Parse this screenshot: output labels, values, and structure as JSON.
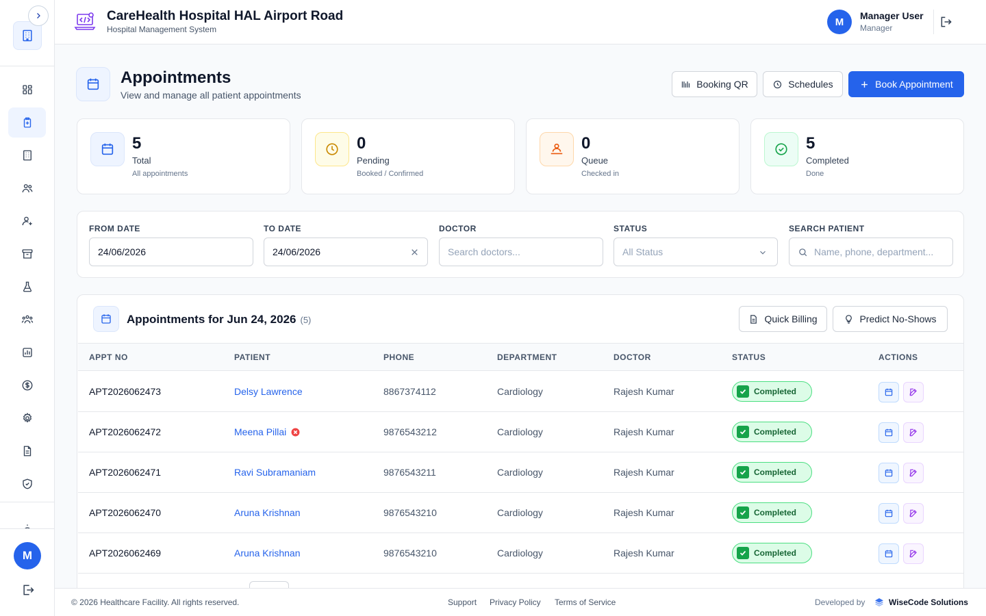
{
  "header": {
    "title": "CareHealth Hospital HAL Airport Road",
    "subtitle": "Hospital Management System",
    "user_initial": "M",
    "user_name": "Manager User",
    "user_role": "Manager"
  },
  "sidebar": {
    "user_initial": "M",
    "items": [
      {
        "icon": "dashboard-icon"
      },
      {
        "icon": "clipboard-icon",
        "active": true
      },
      {
        "icon": "building-icon"
      },
      {
        "icon": "users-icon"
      },
      {
        "icon": "user-plus-icon"
      },
      {
        "icon": "archive-icon"
      },
      {
        "icon": "flask-icon"
      },
      {
        "icon": "team-icon"
      },
      {
        "icon": "bar-chart-icon"
      },
      {
        "icon": "dollar-icon"
      },
      {
        "icon": "gear-icon"
      },
      {
        "icon": "document-icon"
      },
      {
        "icon": "shield-icon"
      }
    ]
  },
  "page": {
    "title": "Appointments",
    "subtitle": "View and manage all patient appointments",
    "buttons": {
      "booking_qr": "Booking QR",
      "schedules": "Schedules",
      "book": "Book Appointment"
    }
  },
  "stats": [
    {
      "value": "5",
      "label": "Total",
      "desc": "All appointments",
      "color": "#2563eb"
    },
    {
      "value": "0",
      "label": "Pending",
      "desc": "Booked / Confirmed",
      "color": "#ca8a04"
    },
    {
      "value": "0",
      "label": "Queue",
      "desc": "Checked in",
      "color": "#ea580c"
    },
    {
      "value": "5",
      "label": "Completed",
      "desc": "Done",
      "color": "#16a34a"
    }
  ],
  "filters": {
    "from_label": "FROM DATE",
    "from_value": "24/06/2026",
    "to_label": "TO DATE",
    "to_value": "24/06/2026",
    "doctor_label": "DOCTOR",
    "doctor_placeholder": "Search doctors...",
    "status_label": "STATUS",
    "status_value": "All Status",
    "search_label": "SEARCH PATIENT",
    "search_placeholder": "Name, phone, department..."
  },
  "table": {
    "title": "Appointments for Jun 24, 2026",
    "count": "(5)",
    "quick_billing": "Quick Billing",
    "predict": "Predict No-Shows",
    "columns": [
      "APPT NO",
      "PATIENT",
      "PHONE",
      "DEPARTMENT",
      "DOCTOR",
      "STATUS",
      "ACTIONS"
    ],
    "rows": [
      {
        "appt": "APT2026062473",
        "patient": "Delsy Lawrence",
        "flag": false,
        "phone": "8867374112",
        "dept": "Cardiology",
        "doctor": "Rajesh Kumar",
        "status": "Completed"
      },
      {
        "appt": "APT2026062472",
        "patient": "Meena Pillai",
        "flag": true,
        "phone": "9876543212",
        "dept": "Cardiology",
        "doctor": "Rajesh Kumar",
        "status": "Completed"
      },
      {
        "appt": "APT2026062471",
        "patient": "Ravi Subramaniam",
        "flag": false,
        "phone": "9876543211",
        "dept": "Cardiology",
        "doctor": "Rajesh Kumar",
        "status": "Completed"
      },
      {
        "appt": "APT2026062470",
        "patient": "Aruna Krishnan",
        "flag": false,
        "phone": "9876543210",
        "dept": "Cardiology",
        "doctor": "Rajesh Kumar",
        "status": "Completed"
      },
      {
        "appt": "APT2026062469",
        "patient": "Aruna Krishnan",
        "flag": false,
        "phone": "9876543210",
        "dept": "Cardiology",
        "doctor": "Rajesh Kumar",
        "status": "Completed"
      }
    ]
  },
  "footer": {
    "copyright": "© 2026 Healthcare Facility. All rights reserved.",
    "support": "Support",
    "privacy": "Privacy Policy",
    "terms": "Terms of Service",
    "developed_by": "Developed by",
    "brand": "WiseCode Solutions"
  }
}
